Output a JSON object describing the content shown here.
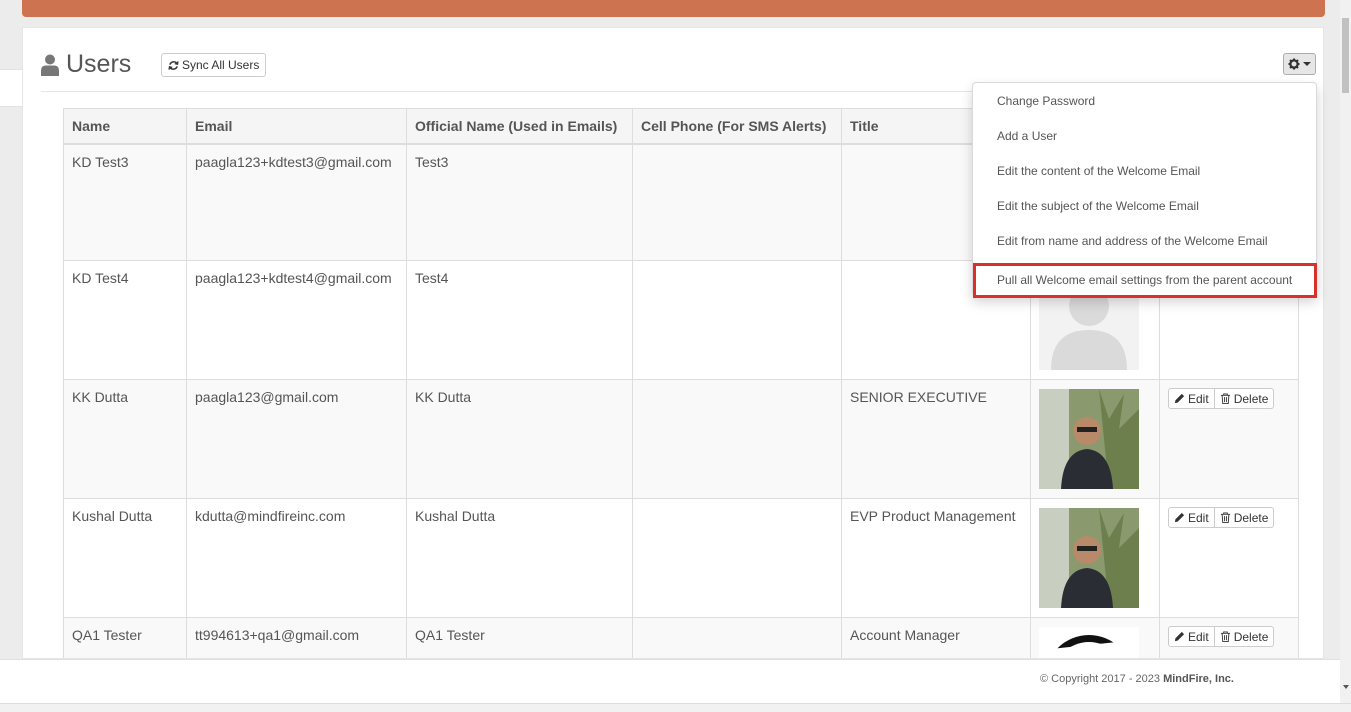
{
  "header": {
    "title": "Users",
    "sync_label": "Sync All Users"
  },
  "table": {
    "columns": [
      "Name",
      "Email",
      "Official Name (Used in Emails)",
      "Cell Phone (For SMS Alerts)",
      "Title"
    ],
    "rows": [
      {
        "name": "KD Test3",
        "email": "paagla123+kdtest3@gmail.com",
        "official": "Test3",
        "phone": "",
        "title": "",
        "avatar": "hidden"
      },
      {
        "name": "KD Test4",
        "email": "paagla123+kdtest4@gmail.com",
        "official": "Test4",
        "phone": "",
        "title": "",
        "avatar": "placeholder-silhouette"
      },
      {
        "name": "KK Dutta",
        "email": "paagla123@gmail.com",
        "official": "KK Dutta",
        "phone": "",
        "title": "SENIOR EXECUTIVE",
        "avatar": "photo"
      },
      {
        "name": "Kushal Dutta",
        "email": "kdutta@mindfireinc.com",
        "official": "Kushal Dutta",
        "phone": "",
        "title": "EVP Product Management",
        "avatar": "photo"
      },
      {
        "name": "QA1 Tester",
        "email": "tt994613+qa1@gmail.com",
        "official": "QA1 Tester",
        "phone": "",
        "title": "Account Manager",
        "avatar": "your-logo"
      }
    ],
    "edit_label": "Edit",
    "delete_label": "Delete"
  },
  "menu": {
    "items": [
      "Change Password",
      "Add a User",
      "Edit the content of the Welcome Email",
      "Edit the subject of the Welcome Email",
      "Edit from name and address of the Welcome Email",
      "Pull all Welcome email settings from the parent account"
    ]
  },
  "footer": {
    "copyright": "© Copyright 2017 - 2023 ",
    "company": "MindFire, Inc."
  },
  "colors": {
    "topbar": "#cd7350",
    "highlight": "#d9302a"
  }
}
